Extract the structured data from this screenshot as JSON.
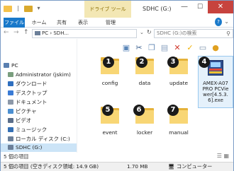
{
  "window": {
    "title": "SDHC (G:)",
    "context_tab": "ドライブ ツール",
    "controls": {
      "minimize": "—",
      "maximize": "☐",
      "close": "✕"
    }
  },
  "ribbon": {
    "tabs": [
      {
        "label": "ファイル"
      },
      {
        "label": "ホーム"
      },
      {
        "label": "共有"
      },
      {
        "label": "表示"
      },
      {
        "label": "管理"
      }
    ]
  },
  "nav": {
    "address": "PC › SDH...",
    "search_placeholder": "SDHC (G:)の検索"
  },
  "sidebar": {
    "items": [
      {
        "label": "PC",
        "color": "#5a7fb0",
        "indent": 0
      },
      {
        "label": "Administrator (jskim)",
        "color": "#7a9e7e",
        "indent": 1
      },
      {
        "label": "ダウンロード",
        "color": "#2f6fbf",
        "indent": 1
      },
      {
        "label": "デスクトップ",
        "color": "#3a7bd5",
        "indent": 1
      },
      {
        "label": "ドキュメント",
        "color": "#8c98a8",
        "indent": 1
      },
      {
        "label": "ピクチャ",
        "color": "#4b8fd1",
        "indent": 1
      },
      {
        "label": "ビデオ",
        "color": "#5a6e8a",
        "indent": 1
      },
      {
        "label": "ミュージック",
        "color": "#3470b5",
        "indent": 1
      },
      {
        "label": "ローカル ディスク (C:)",
        "color": "#6b7f99",
        "indent": 1
      },
      {
        "label": "SDHC (G:)",
        "color": "#6b7f99",
        "indent": 1,
        "selected": true
      }
    ]
  },
  "files": [
    {
      "name": "config",
      "badge": "1",
      "type": "folder"
    },
    {
      "name": "data",
      "badge": "2",
      "type": "folder"
    },
    {
      "name": "update",
      "badge": "3",
      "type": "folder"
    },
    {
      "name": "AMEX-A07 PRO PCVie wer[4.5.3. 6].exe",
      "badge": "4",
      "type": "exe"
    },
    {
      "name": "event",
      "badge": "5",
      "type": "folder"
    },
    {
      "name": "locker",
      "badge": "6",
      "type": "folder"
    },
    {
      "name": "manual",
      "badge": "7",
      "type": "folder"
    }
  ],
  "status": {
    "item_count": "5 個の項目",
    "summary": "5 個の項目 (空きディスク領域: 14.9 GB)",
    "size": "1.70 MB",
    "location": "コンピューター"
  }
}
